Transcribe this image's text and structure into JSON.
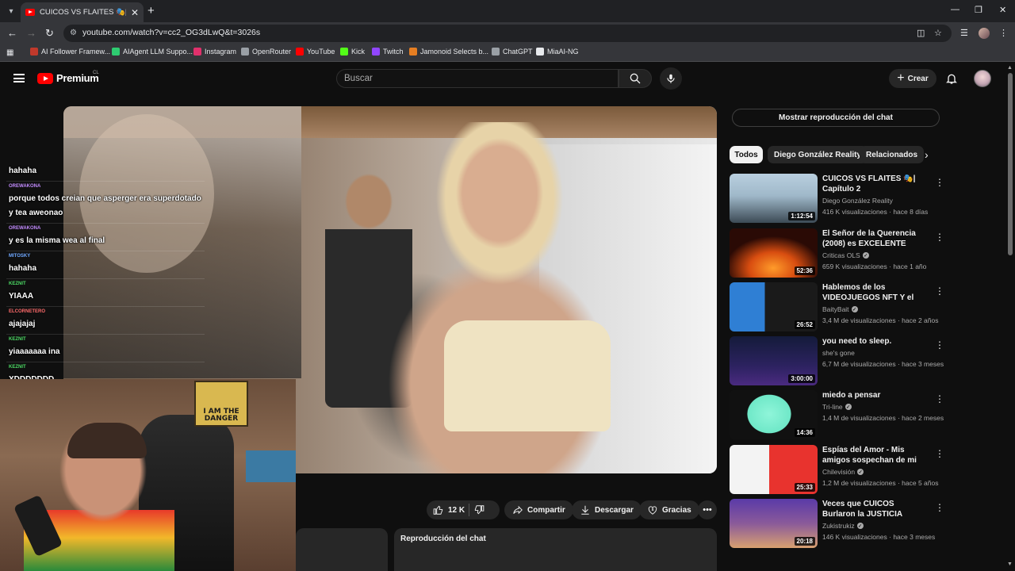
{
  "browser": {
    "tab_title": "CUICOS VS FLAITES 🎭| Capítulo",
    "new_tab": "+",
    "tab_close": "✕",
    "url": "youtube.com/watch?v=cc2_OG3dLwQ&t=3026s"
  },
  "bookmarks": [
    {
      "label": "AI Follower Framew...",
      "color": "#c0392b"
    },
    {
      "label": "AIAgent LLM Suppo...",
      "color": "#2ecc71"
    },
    {
      "label": "Instagram",
      "color": "#e1306c"
    },
    {
      "label": "OpenRouter",
      "color": "#9aa0a6"
    },
    {
      "label": "YouTube",
      "color": "#ff0000"
    },
    {
      "label": "Kick",
      "color": "#53fc18"
    },
    {
      "label": "Twitch",
      "color": "#9146ff"
    },
    {
      "label": "Jamonoid Selects b...",
      "color": "#e67e22"
    },
    {
      "label": "ChatGPT",
      "color": "#9aa0a6"
    },
    {
      "label": "MiaAI-NG",
      "color": "#e8eaed"
    }
  ],
  "header": {
    "logo": "Premium",
    "region": "CL",
    "search_placeholder": "Buscar",
    "create_label": "Crear"
  },
  "chat_overlay": [
    {
      "user": "",
      "text": "hahaha",
      "color": "#ffffff"
    },
    {
      "user": "OREWAKONA",
      "text": "porque todos creian que asperger era superdotado y tea aweonao",
      "color": "#c38cff"
    },
    {
      "user": "OREWAKONA",
      "text": "y es la misma wea al final",
      "color": "#c38cff"
    },
    {
      "user": "MITOSKY",
      "text": "hahaha",
      "color": "#6fa8ff"
    },
    {
      "user": "KEZNIT",
      "text": "YIAAA",
      "color": "#4cd964"
    },
    {
      "user": "ELCORNETERO",
      "text": "ajajajaj",
      "color": "#ff6b6b"
    },
    {
      "user": "KEZNIT",
      "text": "yiaaaaaaa ina",
      "color": "#4cd964"
    },
    {
      "user": "KEZNIT",
      "text": "XDDDDDDD",
      "color": "#4cd964"
    }
  ],
  "webcam_poster": [
    "I AM THE",
    "DANGER"
  ],
  "actions": {
    "likes": "12 K",
    "share": "Compartir",
    "download": "Descargar",
    "thanks": "Gracias"
  },
  "below": {
    "chat_replay": "Reproducción del chat"
  },
  "sidebar": {
    "show_chat": "Mostrar reproducción del chat",
    "chips": [
      "Todos",
      "Diego González Reality",
      "Relacionados"
    ],
    "videos": [
      {
        "title": "CUICOS VS FLAITES 🎭| Capítulo 2",
        "channel": "Diego González Reality",
        "verified": false,
        "views": "416 K visualizaciones",
        "age": "hace 8 días",
        "duration": "1:12:54",
        "thumb_a": "#9fb8c9",
        "thumb_b": "#3c4a55"
      },
      {
        "title": "El Señor de la Querencia (2008) es EXCELENTE",
        "channel": "Criticas OLS",
        "verified": true,
        "views": "659 K visualizaciones",
        "age": "hace 1 año",
        "duration": "52:36",
        "thumb_a": "#ff7a1a",
        "thumb_b": "#2a0a05"
      },
      {
        "title": "Hablemos de los VIDEOJUEGOS NFT Y el METAVERSO | Juego...",
        "channel": "BaityBait",
        "verified": true,
        "views": "3,4 M de visualizaciones",
        "age": "hace 2 años",
        "duration": "26:52",
        "thumb_a": "#2f7fd4",
        "thumb_b": "#f0d21a"
      },
      {
        "title": "you need to sleep.",
        "channel": "she's gone",
        "verified": false,
        "views": "6,7 M de visualizaciones",
        "age": "hace 3 meses",
        "duration": "3:00:00",
        "thumb_a": "#141b3a",
        "thumb_b": "#4a2a80"
      },
      {
        "title": "miedo a pensar",
        "channel": "Tri-line",
        "verified": true,
        "views": "1,4 M de visualizaciones",
        "age": "hace 2 meses",
        "duration": "14:36",
        "thumb_a": "#111111",
        "thumb_b": "#6fe8c8"
      },
      {
        "title": "Espías del Amor - Mis amigos sospechan de mi enamorada",
        "channel": "Chilevisión",
        "verified": true,
        "views": "1,2 M de visualizaciones",
        "age": "hace 5 años",
        "duration": "25:33",
        "thumb_a": "#e8332e",
        "thumb_b": "#f3f3f3"
      },
      {
        "title": "Veces que CUICOS Burlaron la JUSTICIA",
        "channel": "Zukistrukiz",
        "verified": true,
        "views": "146 K visualizaciones",
        "age": "hace 3 meses",
        "duration": "20:18",
        "thumb_a": "#5a3aa8",
        "thumb_b": "#d8a070"
      }
    ]
  }
}
